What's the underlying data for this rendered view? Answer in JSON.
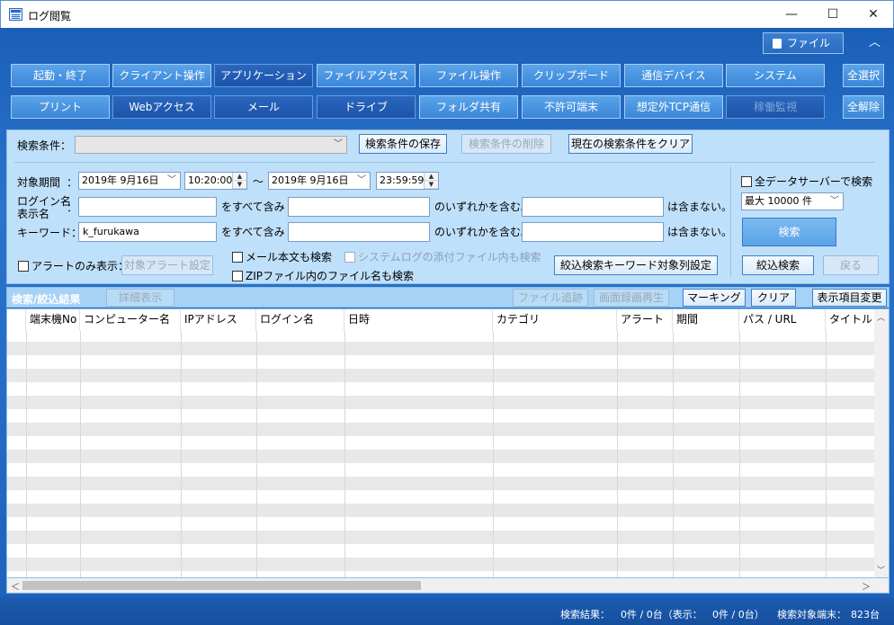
{
  "window": {
    "title": "ログ閲覧",
    "min": "—",
    "max": "☐",
    "close": "✕"
  },
  "toolbar": {
    "file_label": "ファイル"
  },
  "categories_row1": [
    "起動・終了",
    "クライアント操作",
    "アプリケーション",
    "ファイルアクセス",
    "ファイル操作",
    "クリップボード",
    "通信デバイス",
    "システム"
  ],
  "categories_row2": [
    "プリント",
    "Webアクセス",
    "メール",
    "ドライブ",
    "フォルダ共有",
    "不許可端末",
    "想定外TCP通信",
    "稼働監視"
  ],
  "select_all": "全選択",
  "deselect_all": "全解除",
  "search": {
    "condition_label": "検索条件：",
    "save_condition": "検索条件の保存",
    "delete_condition": "検索条件の削除",
    "clear_condition": "現在の検索条件をクリア",
    "period_label": "対象期間",
    "colon": "：",
    "date_from": "2019年  9月16日",
    "time_from": "10:20:00",
    "tilde": "～",
    "date_to": "2019年  9月16日",
    "time_to": "23:59:59",
    "login_label_1": "ログイン名",
    "login_label_2": "表示名",
    "keyword_label": "キーワード：",
    "keyword_value": "k_furukawa",
    "contains_all": "をすべて含み",
    "contains_any": "のいずれかを含む。",
    "not_contains": "は含まない。",
    "alert_only": "アラートのみ表示：",
    "alert_settings": "対象アラート設定",
    "mail_body": "メール本文も検索",
    "syslog_attach": "システムログの添付ファイル内も検索",
    "zip_files": "ZIPファイル内のファイル名も検索",
    "keyword_columns": "絞込検索キーワード対象列設定",
    "all_servers": "全データサーバーで検索",
    "max_count": "最大 10000 件",
    "search_button": "検索",
    "refine_button": "絞込検索",
    "back_button": "戻る"
  },
  "results": {
    "title": "検索/絞込結果",
    "detail": "詳細表示",
    "file_trace": "ファイル追跡",
    "screen_replay": "画面録画再生",
    "marking": "マーキング",
    "clear": "クリア",
    "columns_change": "表示項目変更",
    "columns": [
      "",
      "端末機No",
      "コンピューター名",
      "IPアドレス",
      "ログイン名",
      "日時",
      "カテゴリ",
      "アラート",
      "期間",
      "パス / URL",
      "タイトル"
    ]
  },
  "status": {
    "results_label": "検索結果：",
    "results_value": "0件 / 0台（表示：",
    "display_value": "0件 / 0台）",
    "target_label": "検索対象端末：",
    "target_value": "823台"
  }
}
